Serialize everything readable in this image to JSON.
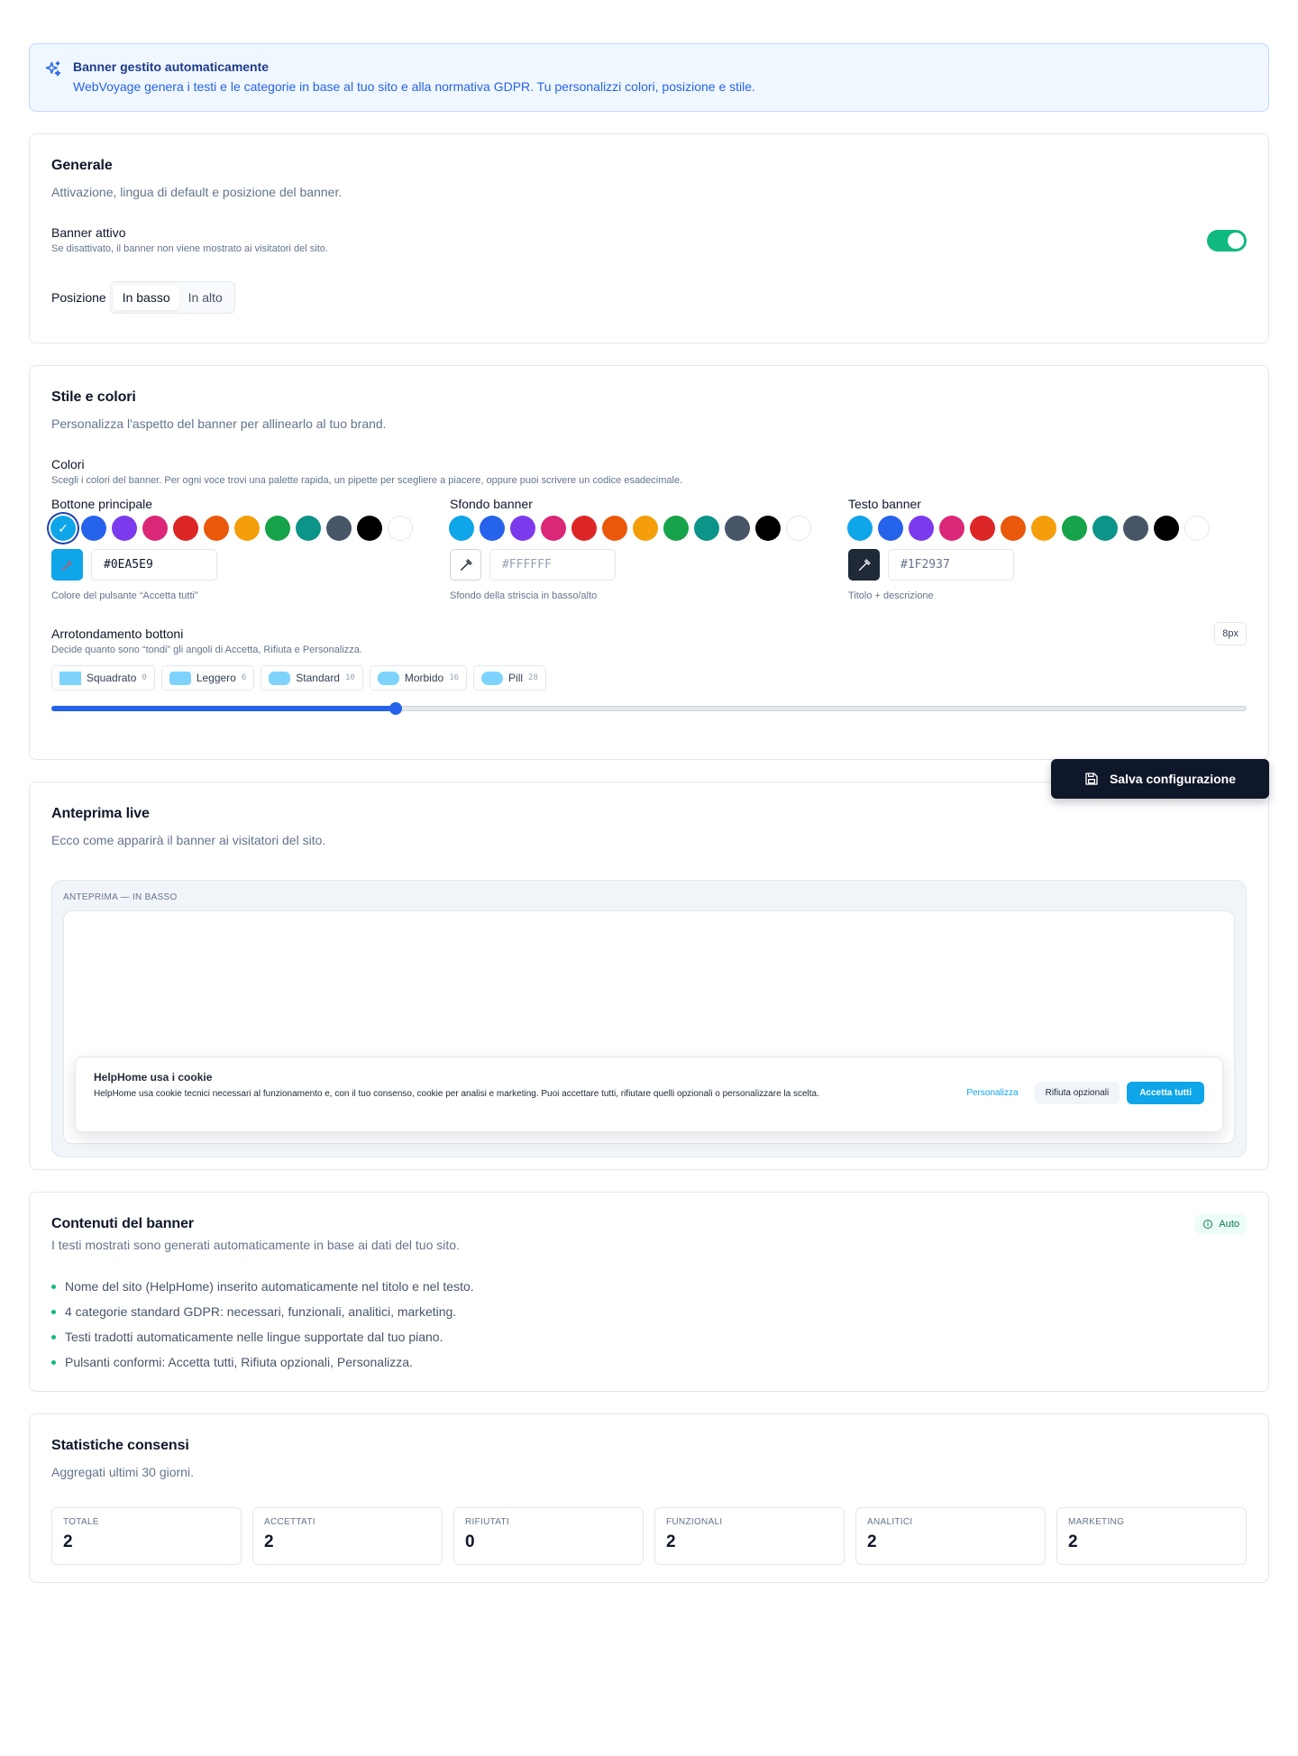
{
  "info": {
    "title": "Banner gestito automaticamente",
    "text": "WebVoyage genera i testi e le categorie in base al tuo sito e alla normativa GDPR. Tu personalizzi colori, posizione e stile."
  },
  "general": {
    "title": "Generale",
    "subtitle": "Attivazione, lingua di default e posizione del banner.",
    "active_label": "Banner attivo",
    "active_help": "Se disattivato, il banner non viene mostrato ai visitatori del sito.",
    "active": true,
    "position_label": "Posizione",
    "position_options": [
      "In basso",
      "In alto"
    ],
    "position_selected": "In basso"
  },
  "style": {
    "title": "Stile e colori",
    "subtitle": "Personalizza l'aspetto del banner per allinearlo al tuo brand.",
    "colors_label": "Colori",
    "colors_help": "Scegli i colori del banner. Per ogni voce trovi una palette rapida, un pipette per scegliere a piacere, oppure puoi scrivere un codice esadecimale.",
    "palette": [
      "#0ea5e9",
      "#2563eb",
      "#7c3aed",
      "#db2777",
      "#dc2626",
      "#ea580c",
      "#f59e0b",
      "#16a34a",
      "#0d9488",
      "#475569",
      "#000000",
      "#ffffff"
    ],
    "groups": [
      {
        "label": "Bottone principale",
        "hex": "#0EA5E9",
        "help": "Colore del pulsante “Accetta tutti”",
        "selected_index": 0
      },
      {
        "label": "Sfondo banner",
        "hex": "#FFFFFF",
        "help": "Sfondo della striscia in basso/alto",
        "selected_index": -1
      },
      {
        "label": "Testo banner",
        "hex": "#1F2937",
        "help": "Titolo + descrizione",
        "selected_index": -1
      }
    ],
    "radius_label": "Arrotondamento bottoni",
    "radius_help": "Decide quanto sono “tondi” gli angoli di Accetta, Rifiuta e Personalizza.",
    "radius_value": "8px",
    "radius_presets": [
      {
        "label": "Squadrato",
        "value": "0"
      },
      {
        "label": "Leggero",
        "value": "6"
      },
      {
        "label": "Standard",
        "value": "10"
      },
      {
        "label": "Morbido",
        "value": "16"
      },
      {
        "label": "Pill",
        "value": "28"
      }
    ],
    "radius_slider_fraction": 0.288
  },
  "save_label": "Salva configurazione",
  "preview": {
    "title": "Anteprima live",
    "subtitle": "Ecco come apparirà il banner ai visitatori del sito.",
    "label": "ANTEPRIMA — IN BASSO",
    "cookie_title": "HelpHome usa i cookie",
    "cookie_text": "HelpHome usa cookie tecnici necessari al funzionamento e, con il tuo consenso, cookie per analisi e marketing. Puoi accettare tutti, rifiutare quelli opzionali o personalizzare la scelta.",
    "btn_customize": "Personalizza",
    "btn_reject": "Rifiuta opzionali",
    "btn_accept": "Accetta tutti"
  },
  "contents": {
    "title": "Contenuti del banner",
    "subtitle": "I testi mostrati sono generati automaticamente in base ai dati del tuo sito.",
    "badge": "Auto",
    "items": [
      "Nome del sito (HelpHome) inserito automaticamente nel titolo e nel testo.",
      "4 categorie standard GDPR: necessari, funzionali, analitici, marketing.",
      "Testi tradotti automaticamente nelle lingue supportate dal tuo piano.",
      "Pulsanti conformi: Accetta tutti, Rifiuta opzionali, Personalizza."
    ]
  },
  "stats": {
    "title": "Statistiche consensi",
    "subtitle": "Aggregati ultimi 30 giorni.",
    "items": [
      {
        "label": "TOTALE",
        "value": "2"
      },
      {
        "label": "ACCETTATI",
        "value": "2"
      },
      {
        "label": "RIFIUTATI",
        "value": "0"
      },
      {
        "label": "FUNZIONALI",
        "value": "2"
      },
      {
        "label": "ANALITICI",
        "value": "2"
      },
      {
        "label": "MARKETING",
        "value": "2"
      }
    ]
  }
}
